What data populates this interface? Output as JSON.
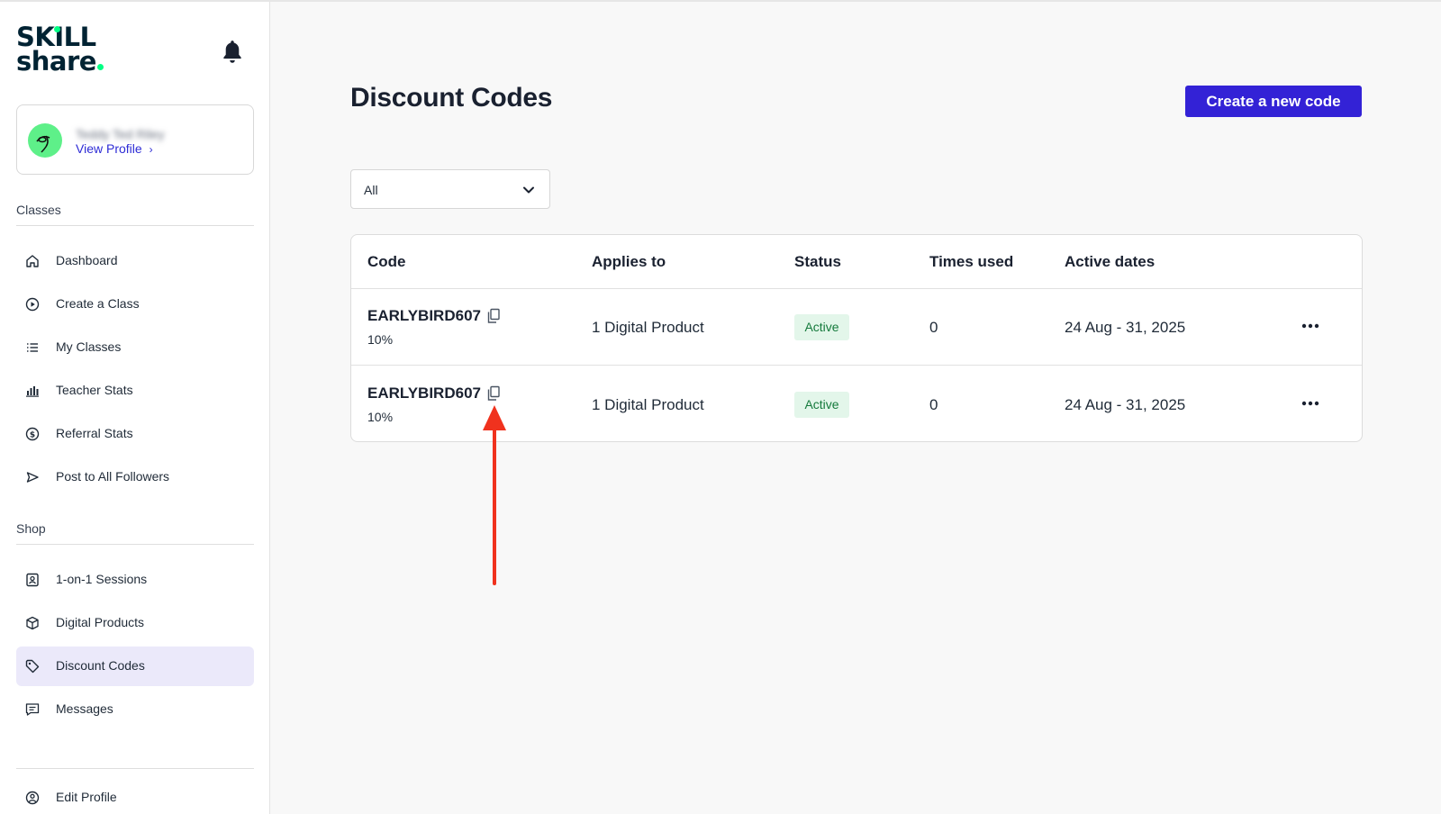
{
  "brand": {
    "line1": "SKILL",
    "line2": "share",
    "accent_color": "#00ff84"
  },
  "profile": {
    "name": "Teddy Ted Riley",
    "view_profile_label": "View Profile"
  },
  "sections": {
    "classes_label": "Classes",
    "shop_label": "Shop"
  },
  "nav": {
    "classes": [
      {
        "label": "Dashboard",
        "icon": "home-icon"
      },
      {
        "label": "Create a Class",
        "icon": "play-circle-icon"
      },
      {
        "label": "My Classes",
        "icon": "list-icon"
      },
      {
        "label": "Teacher Stats",
        "icon": "bar-chart-icon"
      },
      {
        "label": "Referral Stats",
        "icon": "dollar-circle-icon"
      },
      {
        "label": "Post to All Followers",
        "icon": "send-icon"
      }
    ],
    "shop": [
      {
        "label": "1-on-1 Sessions",
        "icon": "contact-card-icon"
      },
      {
        "label": "Digital Products",
        "icon": "box-icon"
      },
      {
        "label": "Discount Codes",
        "icon": "tag-icon",
        "active": true
      },
      {
        "label": "Messages",
        "icon": "message-icon"
      }
    ],
    "footer": {
      "label": "Edit Profile",
      "icon": "user-circle-icon"
    }
  },
  "main": {
    "title": "Discount Codes",
    "create_button_label": "Create a new code",
    "filter": {
      "selected": "All"
    },
    "table": {
      "headers": [
        "Code",
        "Applies to",
        "Status",
        "Times used",
        "Active dates"
      ],
      "rows": [
        {
          "code": "EARLYBIRD607",
          "discount": "10%",
          "applies_to": "1 Digital Product",
          "status": "Active",
          "times_used": "0",
          "active_dates": "24 Aug - 31, 2025"
        },
        {
          "code": "EARLYBIRD607",
          "discount": "10%",
          "applies_to": "1 Digital Product",
          "status": "Active",
          "times_used": "0",
          "active_dates": "24 Aug - 31, 2025"
        }
      ]
    }
  },
  "colors": {
    "primary": "#3322d6",
    "active_nav_bg": "#ebe9fa",
    "status_bg": "#e3f6ea",
    "status_text": "#157a3c",
    "annotation_arrow": "#f0321e"
  }
}
